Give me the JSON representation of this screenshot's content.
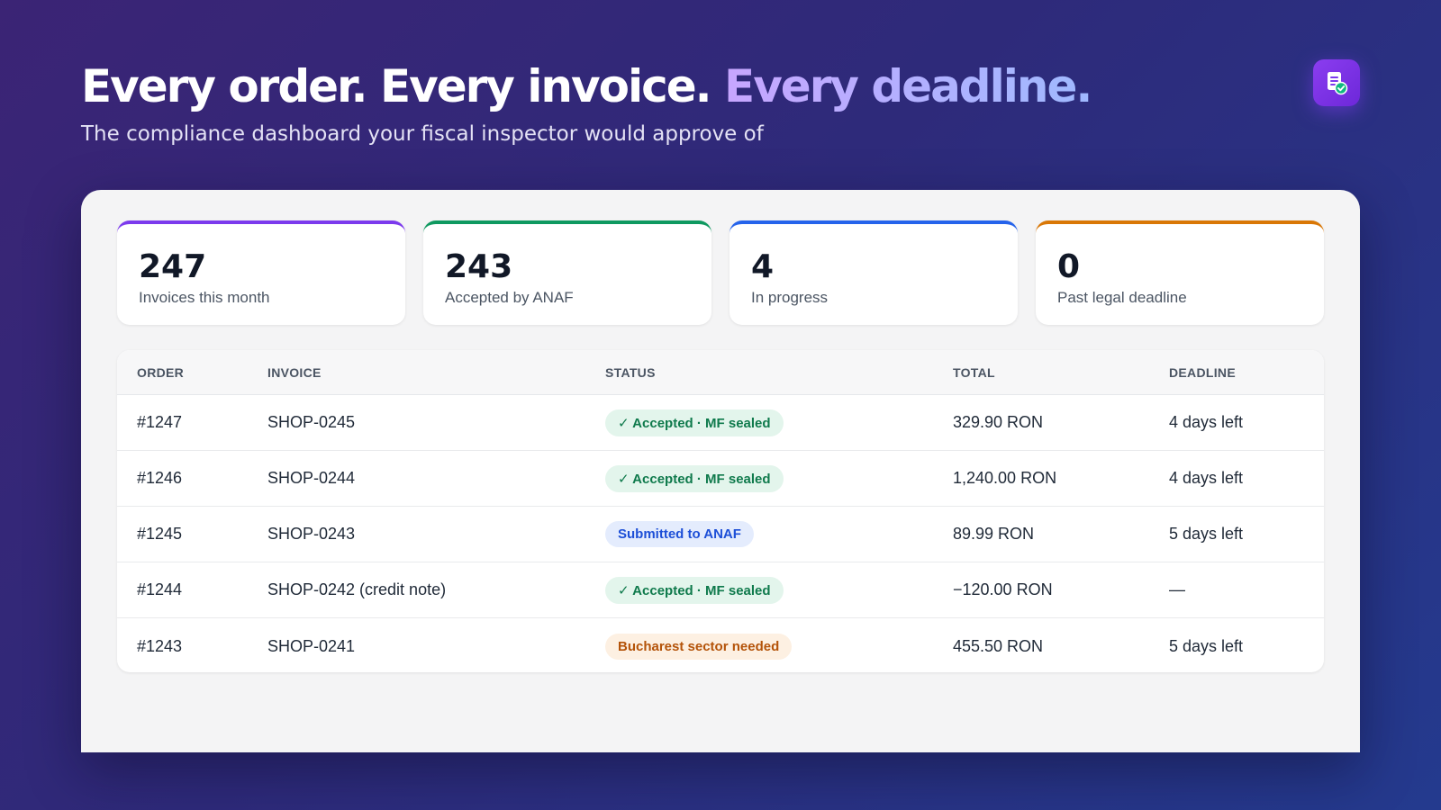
{
  "hero": {
    "headline_main": "Every order. Every invoice. ",
    "headline_accent": "Every deadline.",
    "subtitle": "The compliance dashboard your fiscal inspector would approve of"
  },
  "logo": {
    "icon": "document-check-icon"
  },
  "colors": {
    "purple": "#7c3aed",
    "green": "#0f9960",
    "blue": "#2563eb",
    "orange": "#d97706"
  },
  "stats": [
    {
      "value": "247",
      "label": "Invoices this month",
      "color": "#7c3aed"
    },
    {
      "value": "243",
      "label": "Accepted by ANAF",
      "color": "#0f9960"
    },
    {
      "value": "4",
      "label": "In progress",
      "color": "#2563eb"
    },
    {
      "value": "0",
      "label": "Past legal deadline",
      "color": "#d97706"
    }
  ],
  "table": {
    "headers": {
      "order": "ORDER",
      "invoice": "INVOICE",
      "status": "STATUS",
      "total": "TOTAL",
      "deadline": "DEADLINE"
    },
    "rows": [
      {
        "order": "#1247",
        "invoice": "SHOP-0245",
        "status": "✓ Accepted · MF sealed",
        "status_type": "green",
        "total": "329.90 RON",
        "deadline": "4 days left"
      },
      {
        "order": "#1246",
        "invoice": "SHOP-0244",
        "status": "✓ Accepted · MF sealed",
        "status_type": "green",
        "total": "1,240.00 RON",
        "deadline": "4 days left"
      },
      {
        "order": "#1245",
        "invoice": "SHOP-0243",
        "status": "Submitted to ANAF",
        "status_type": "blue",
        "total": "89.99 RON",
        "deadline": "5 days left"
      },
      {
        "order": "#1244",
        "invoice": "SHOP-0242 (credit note)",
        "status": "✓ Accepted · MF sealed",
        "status_type": "green",
        "total": "−120.00 RON",
        "deadline": "—"
      },
      {
        "order": "#1243",
        "invoice": "SHOP-0241",
        "status": "Bucharest sector needed",
        "status_type": "orange",
        "total": "455.50 RON",
        "deadline": "5 days left"
      }
    ]
  }
}
